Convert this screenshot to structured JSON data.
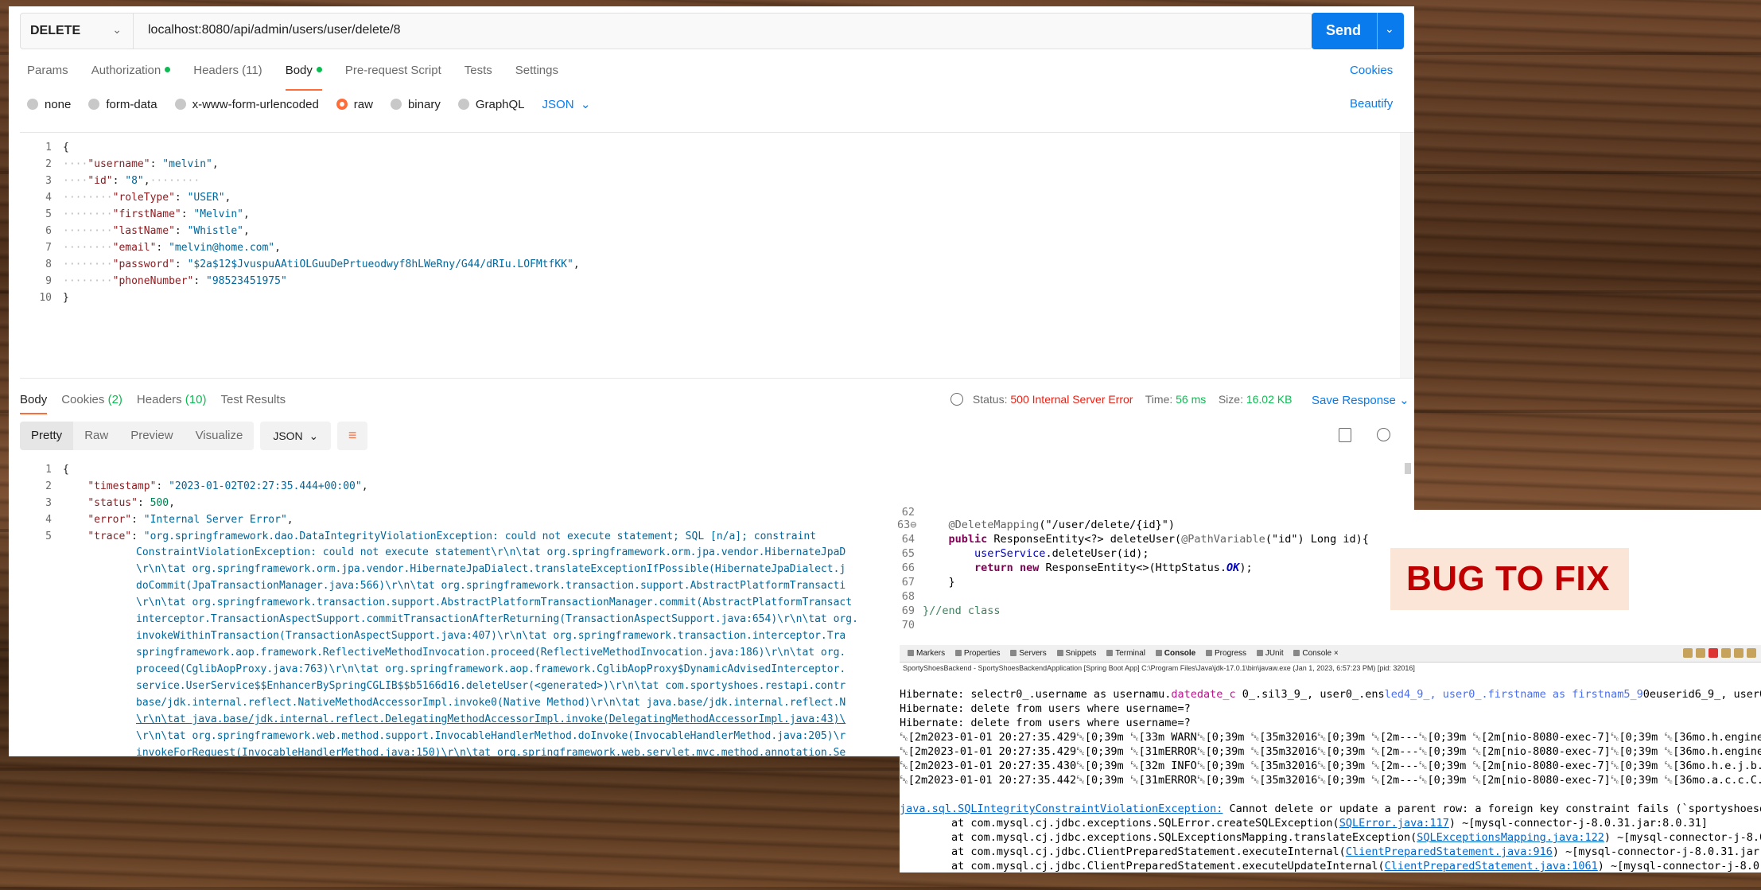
{
  "request": {
    "method": "DELETE",
    "url": "localhost:8080/api/admin/users/user/delete/8",
    "send_label": "Send",
    "tabs": [
      {
        "label": "Params"
      },
      {
        "label": "Authorization"
      },
      {
        "label": "Headers (11)"
      },
      {
        "label": "Body"
      },
      {
        "label": "Pre-request Script"
      },
      {
        "label": "Tests"
      },
      {
        "label": "Settings"
      }
    ],
    "cookies_label": "Cookies",
    "body_types": [
      "none",
      "form-data",
      "x-www-form-urlencoded",
      "raw",
      "binary",
      "GraphQL"
    ],
    "selected_body_type": "raw",
    "format": "JSON",
    "beautify_label": "Beautify",
    "line_numbers": [
      "1",
      "2",
      "3",
      "4",
      "5",
      "6",
      "7",
      "8",
      "9",
      "10"
    ],
    "body": {
      "open": "{",
      "close": "}",
      "fields": [
        {
          "key": "\"username\"",
          "value": "\"melvin\"",
          "tail": ","
        },
        {
          "key": "\"id\"",
          "value": "\"8\"",
          "tail": ","
        },
        {
          "key": "\"roleType\"",
          "value": "\"USER\"",
          "tail": ","
        },
        {
          "key": "\"firstName\"",
          "value": "\"Melvin\"",
          "tail": ","
        },
        {
          "key": "\"lastName\"",
          "value": "\"Whistle\"",
          "tail": ","
        },
        {
          "key": "\"email\"",
          "value": "\"melvin@home.com\"",
          "tail": ","
        },
        {
          "key": "\"password\"",
          "value": "\"$2a$12$JvuspuAAtiOLGuuDePrtueodwyf8hLWeRny/G44/dRIu.LOFMtfKK\"",
          "tail": ","
        },
        {
          "key": "\"phoneNumber\"",
          "value": "\"98523451975\"",
          "tail": ""
        }
      ]
    }
  },
  "response": {
    "tabs": [
      {
        "label": "Body"
      },
      {
        "label": "Cookies",
        "count": "(2)"
      },
      {
        "label": "Headers",
        "count": "(10)"
      },
      {
        "label": "Test Results"
      }
    ],
    "status_label": "Status:",
    "status_value": "500 Internal Server Error",
    "time_label": "Time:",
    "time_value": "56 ms",
    "size_label": "Size:",
    "size_value": "16.02 KB",
    "save_label": "Save Response",
    "views": [
      "Pretty",
      "Raw",
      "Preview",
      "Visualize"
    ],
    "format": "JSON",
    "line_numbers": [
      "1",
      "2",
      "3",
      "4",
      "5"
    ],
    "open": "{",
    "timestamp_key": "\"timestamp\"",
    "timestamp_value": "\"2023-01-02T02:27:35.444+00:00\"",
    "status_key": "\"status\"",
    "status_num": "500",
    "error_key": "\"error\"",
    "error_value": "\"Internal Server Error\"",
    "trace_key": "\"trace\"",
    "trace_first": "\"org.springframework.dao.DataIntegrityViolationException: could not execute statement; SQL [n/a]; constraint",
    "trace_lines": [
      "ConstraintViolationException: could not execute statement\\r\\n\\tat org.springframework.orm.jpa.vendor.HibernateJpaD",
      "\\r\\n\\tat org.springframework.orm.jpa.vendor.HibernateJpaDialect.translateExceptionIfPossible(HibernateJpaDialect.j",
      "doCommit(JpaTransactionManager.java:566)\\r\\n\\tat org.springframework.transaction.support.AbstractPlatformTransacti",
      "\\r\\n\\tat org.springframework.transaction.support.AbstractPlatformTransactionManager.commit(AbstractPlatformTransact",
      "interceptor.TransactionAspectSupport.commitTransactionAfterReturning(TransactionAspectSupport.java:654)\\r\\n\\tat org.",
      "invokeWithinTransaction(TransactionAspectSupport.java:407)\\r\\n\\tat org.springframework.transaction.interceptor.Tra",
      "springframework.aop.framework.ReflectiveMethodInvocation.proceed(ReflectiveMethodInvocation.java:186)\\r\\n\\tat org.",
      "proceed(CglibAopProxy.java:763)\\r\\n\\tat org.springframework.aop.framework.CglibAopProxy$DynamicAdvisedInterceptor.",
      "service.UserService$$EnhancerBySpringCGLIB$$b5166d16.deleteUser(<generated>)\\r\\n\\tat com.sportyshoes.restapi.contr",
      "base/jdk.internal.reflect.NativeMethodAccessorImpl.invoke0(Native Method)\\r\\n\\tat java.base/jdk.internal.reflect.N",
      "\\r\\n\\tat java.base/jdk.internal.reflect.DelegatingMethodAccessorImpl.invoke(DelegatingMethodAccessorImpl.java:43)\\",
      "\\r\\n\\tat org.springframework.web.method.support.InvocableHandlerMethod.doInvoke(InvocableHandlerMethod.java:205)\\r",
      "invokeForRequest(InvocableHandlerMethod.java:150)\\r\\n\\tat org.springframework.web.servlet.mvc.method.annotation.Se"
    ]
  },
  "code": {
    "line_numbers": [
      "62",
      "63⊖",
      "64",
      "65",
      "66",
      "67",
      "68",
      "69",
      "70"
    ],
    "annotation": "@DeleteMapping",
    "mapping": "(\"/user/delete/{id}\")",
    "kw_public": "public",
    "sig_mid": " ResponseEntity<?> deleteUser(",
    "path_var": "@PathVariable",
    "path_arg": "(\"id\")",
    "sig_tail": " Long id){",
    "service_field": "userService",
    "service_call": ".deleteUser(id);",
    "kw_return": "return",
    "kw_new": "new",
    "return_mid": " ResponseEntity<>(HttpStatus.",
    "status_const": "OK",
    "return_tail": ");",
    "close_brace": "}",
    "end_comment": "}//end class"
  },
  "bug_label": "BUG TO FIX",
  "console": {
    "tabs": [
      "Markers",
      "Properties",
      "Servers",
      "Snippets",
      "Terminal",
      "Console",
      "Progress",
      "JUnit",
      "Console"
    ],
    "caption": "SportyShoesBackend - SportyShoesBackendApplication [Spring Boot App] C:\\Program Files\\Java\\jdk-17.0.1\\bin\\javaw.exe  (Jan 1, 2023, 6:57:23 PM) [pid: 32016]",
    "hib1_pre": "Hibernate: select",
    "hib1_rest": "r0_.username as usernamu.",
    "hib1_date": "dated",
    "hib1_date2": "ate_c",
    "hib1_mid": " 0_.sil3_9_, user0_.ens",
    "hib1_blue": "led4_9_, user0_.firstname as firstnam5_9",
    "hib1_end": "0euserid6_9_, user0_.",
    "hib2": "Hibernate: delete from users where username=?",
    "hib3": "Hibernate: delete from users where username=?",
    "log": [
      "␛[2m2023-01-01 20:27:35.429␛[0;39m ␛[33m WARN␛[0;39m ␛[35m32016␛[0;39m ␛[2m---␛[0;39m ␛[2m[nio-8080-exec-7]␛[0;39m ␛[36mo.h.engine.jdbc.",
      "␛[2m2023-01-01 20:27:35.429␛[0;39m ␛[31mERROR␛[0;39m ␛[35m32016␛[0;39m ␛[2m---␛[0;39m ␛[2m[nio-8080-exec-7]␛[0;39m ␛[36mo.h.engine.jdbc.",
      "␛[2m2023-01-01 20:27:35.430␛[0;39m ␛[32m INFO␛[0;39m ␛[35m32016␛[0;39m ␛[2m---␛[0;39m ␛[2m[nio-8080-exec-7]␛[0;39m ␛[36mo.h.e.j.b.intern",
      "␛[2m2023-01-01 20:27:35.442␛[0;39m ␛[31mERROR␛[0;39m ␛[35m32016␛[0;39m ␛[2m---␛[0;39m ␛[2m[nio-8080-exec-7]␛[0;39m ␛[36mo.a.c.c.C.[.[.[/"
    ],
    "exc_link": "java.sql.SQLIntegrityConstraintViolationException:",
    "exc_msg": " Cannot delete or update a parent row: a foreign key constraint fails (`sportyshoesdb`",
    "stack": [
      {
        "pre": "        at com.mysql.cj.jdbc.exceptions.SQLError.createSQLException(",
        "link": "SQLError.java:117",
        "post": ") ~[mysql-connector-j-8.0.31.jar:8.0.31]"
      },
      {
        "pre": "        at com.mysql.cj.jdbc.exceptions.SQLExceptionsMapping.translateException(",
        "link": "SQLExceptionsMapping.java:122",
        "post": ") ~[mysql-connector-j-8.0.3"
      },
      {
        "pre": "        at com.mysql.cj.jdbc.ClientPreparedStatement.executeInternal(",
        "link": "ClientPreparedStatement.java:916",
        "post": ") ~[mysql-connector-j-8.0.31.jar:8."
      },
      {
        "pre": "        at com.mysql.cj.jdbc.ClientPreparedStatement.executeUpdateInternal(",
        "link": "ClientPreparedStatement.java:1061",
        "post": ") ~[mysql-connector-j-8.0.31"
      }
    ]
  },
  "colors": {
    "accent": "#ff6c37",
    "link": "#097bed",
    "status_error": "#eb2013",
    "success": "#0cbb52",
    "bug_text": "#c00000",
    "bug_bg": "#fbe5d6"
  }
}
